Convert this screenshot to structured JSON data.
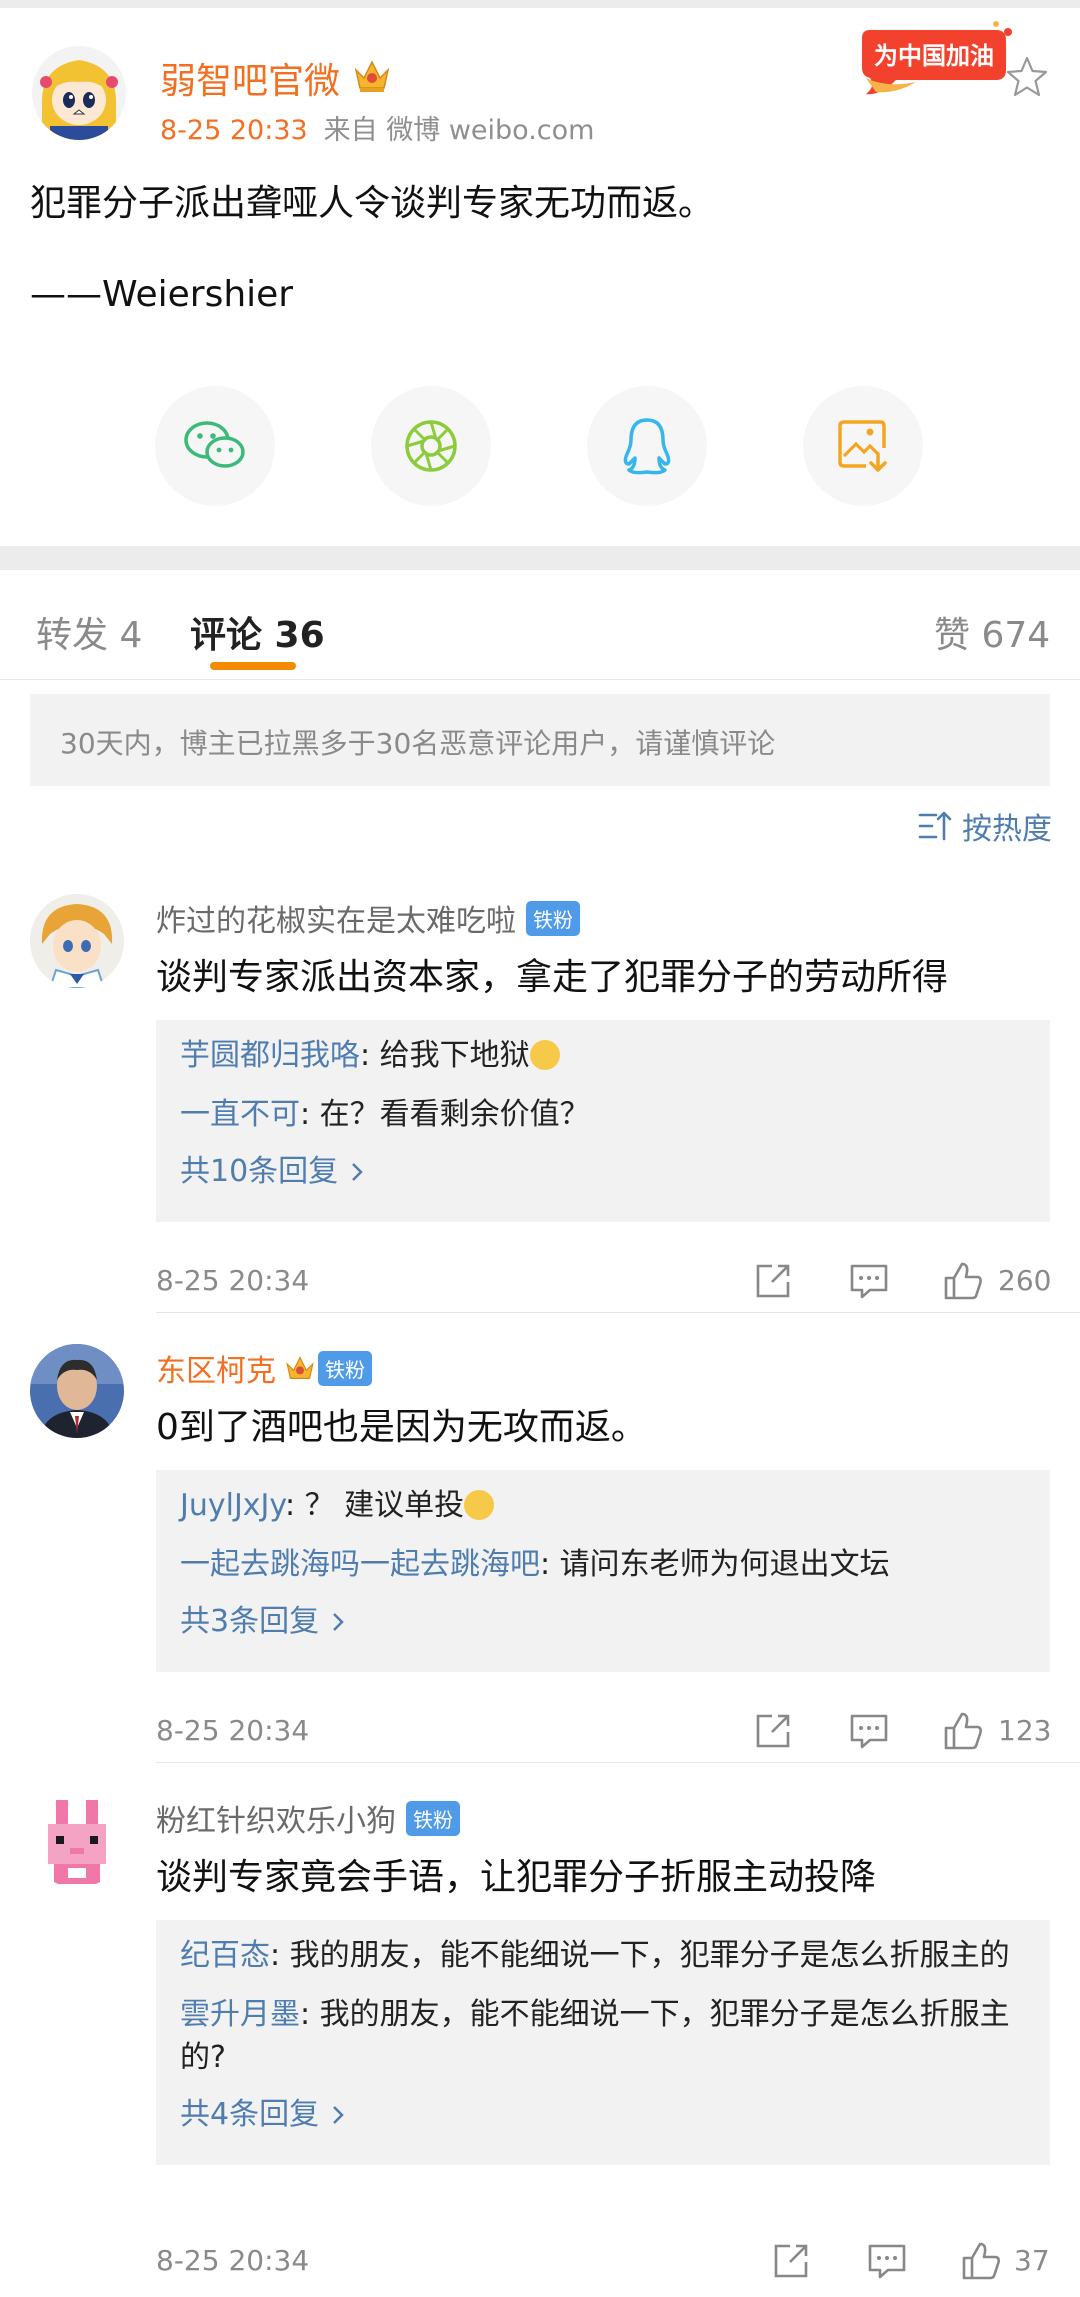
{
  "post": {
    "author": "弱智吧官微",
    "time": "8-25 20:33",
    "source": "来自 微博 weibo.com",
    "text": "犯罪分子派出聋哑人令谈判专家无功而返。",
    "signature": "——Weiershier",
    "promo_badge": "为中国加油"
  },
  "share": [
    "wechat-icon",
    "moments-icon",
    "qq-icon",
    "save-image-icon"
  ],
  "tabs": {
    "repost": "转发 4",
    "comments": "评论 36",
    "likes": "赞 674"
  },
  "notice": "30天内，博主已拉黑多于30名恶意评论用户，请谨慎评论",
  "sort_label": "按热度",
  "fan_badge": "铁粉",
  "colors": {
    "accent": "#f36f21",
    "link": "#507daf",
    "tab_indicator": "#f38b00",
    "fan_badge": "#4f9be8"
  },
  "comments": [
    {
      "user": "炸过的花椒实在是太难吃啦",
      "text": "谈判专家派出资本家，拿走了犯罪分子的劳动所得",
      "replies": [
        {
          "user": "芋圆都归我咯",
          "text": ": 给我下地狱"
        },
        {
          "user": "一直不可",
          "text": ": 在？看看剩余价值？"
        }
      ],
      "more": "共10条回复",
      "time": "8-25 20:34",
      "likes": "260"
    },
    {
      "user": "东区柯克",
      "text": "0到了酒吧也是因为无攻而返。",
      "replies": [
        {
          "user": "JuylJxJy",
          "text": ": ？ 建议单投"
        },
        {
          "user": "一起去跳海吗一起去跳海吧",
          "text": ": 请问东老师为何退出文坛"
        }
      ],
      "more": "共3条回复",
      "time": "8-25 20:34",
      "likes": "123"
    },
    {
      "user": "粉红针织欢乐小狗",
      "text": "谈判专家竟会手语，让犯罪分子折服主动投降",
      "replies": [
        {
          "user": "纪百态",
          "text": ": 我的朋友，能不能细说一下，犯罪分子是怎么折服主的"
        },
        {
          "user": "雲升月墨",
          "text": ": 我的朋友，能不能细说一下，犯罪分子是怎么折服主的?"
        }
      ],
      "more": "共4条回复",
      "time": "8-25 20:34",
      "likes": "37"
    }
  ]
}
